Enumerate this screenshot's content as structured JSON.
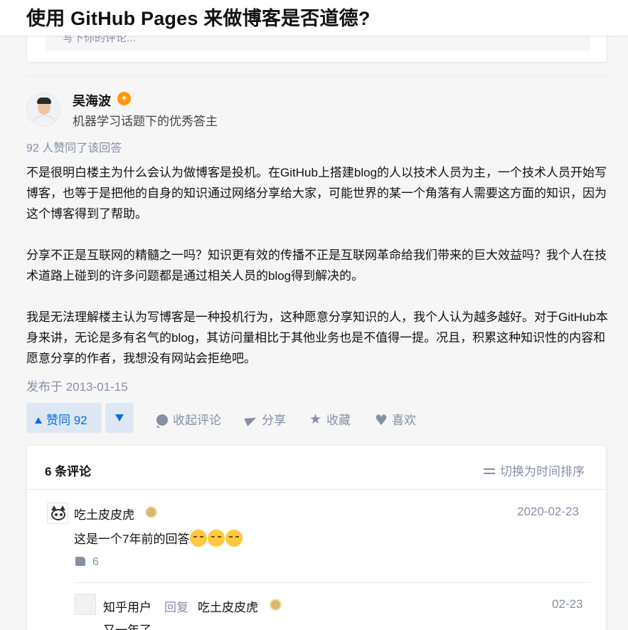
{
  "page": {
    "title": "使用 GitHub Pages 来做博客是否道德?"
  },
  "previous_comment_box": {
    "placeholder": "写下你的评论..."
  },
  "answer": {
    "author": {
      "name": "吴海波",
      "headline": "机器学习话题下的优秀答主",
      "badge_color": "#ff9607"
    },
    "vote_summary": "92 人赞同了该回答",
    "paragraphs": [
      "不是很明白楼主为什么会认为做博客是投机。在GitHub上搭建blog的人以技术人员为主，一个技术人员开始写博客，也等于是把他的自身的知识通过网络分享给大家，可能世界的某一个角落有人需要这方面的知识，因为这个博客得到了帮助。",
      "分享不正是互联网的精髓之一吗？知识更有效的传播不正是互联网革命给我们带来的巨大效益吗？我个人在技术道路上碰到的许多问题都是通过相关人员的blog得到解决的。",
      "我是无法理解楼主认为写博客是一种投机行为，这种愿意分享知识的人，我个人认为越多越好。对于GitHub本身来讲，无论是多有名气的blog，其访问量相比于其他业务也是不值得一提。况且，积累这种知识性的内容和愿意分享的作者，我想没有网站会拒绝吧。"
    ],
    "publish_time": "发布于 2013-01-15",
    "actions": {
      "upvote_label": "赞同 92",
      "collapse_comments": "收起评论",
      "share": "分享",
      "favorite": "收藏",
      "like": "喜欢"
    },
    "accent_color": "#056de8"
  },
  "comments": {
    "count_label": "6 条评论",
    "sort_toggle": "切换为时间排序",
    "items": [
      {
        "author": "吃土皮皮虎",
        "time": "2020-02-23",
        "text": "这是一个7年前的回答",
        "emoji_count": 3,
        "like_count": "6"
      }
    ],
    "reply": {
      "author": "知乎用户",
      "reply_word": "回复",
      "reply_to": "吃土皮皮虎",
      "time": "02-23",
      "text": "又一年了"
    }
  }
}
